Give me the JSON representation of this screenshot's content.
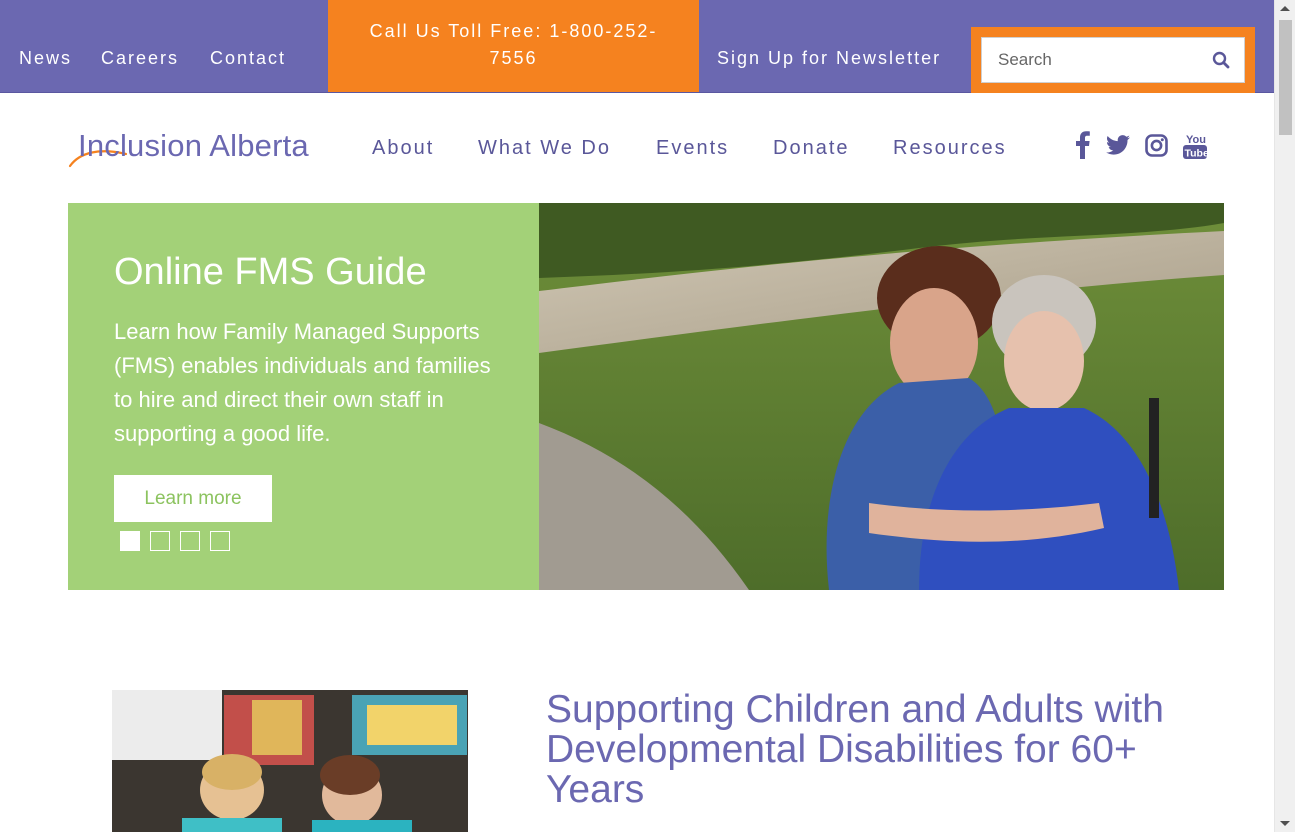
{
  "topbar": {
    "links": [
      "News",
      "Careers",
      "Contact"
    ],
    "call": "Call Us Toll Free: 1-800-252-7556",
    "newsletter": "Sign Up for Newsletter",
    "search_placeholder": "Search"
  },
  "header": {
    "logo_text": "Inclusion Alberta",
    "nav": [
      "About",
      "What We Do",
      "Events",
      "Donate",
      "Resources"
    ],
    "social_icons": [
      "facebook-icon",
      "twitter-icon",
      "instagram-icon",
      "youtube-icon"
    ],
    "youtube_label_top": "You",
    "youtube_label_bottom": "Tube"
  },
  "hero": {
    "title": "Online FMS Guide",
    "body": "Learn how Family Managed Supports (FMS) enables individuals and families to hire and direct their own staff in supporting a good life.",
    "button": "Learn more",
    "slide_count": 4,
    "active_slide": 1
  },
  "lower": {
    "heading": "Supporting Children and Adults with Developmental Disabilities for 60+ Years"
  },
  "colors": {
    "brand_purple": "#6b68b1",
    "accent_orange": "#f5821f",
    "hero_green": "#a3d178"
  }
}
